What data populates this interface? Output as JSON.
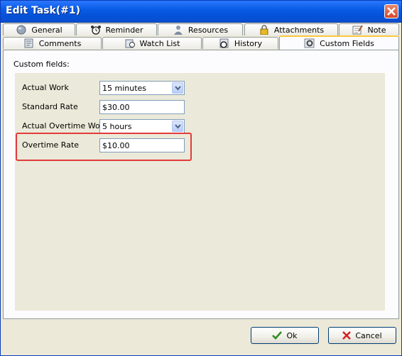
{
  "window": {
    "title": "Edit Task(#1)"
  },
  "tabs_top": [
    {
      "label": "General",
      "icon": "globe-icon"
    },
    {
      "label": "Reminder",
      "icon": "alarm-clock-icon"
    },
    {
      "label": "Resources",
      "icon": "user-icon"
    },
    {
      "label": "Attachments",
      "icon": "lock-icon"
    },
    {
      "label": "Note",
      "icon": "notepad-icon"
    }
  ],
  "tabs_bottom": [
    {
      "label": "Comments",
      "icon": "comments-icon"
    },
    {
      "label": "Watch List",
      "icon": "watch-list-icon"
    },
    {
      "label": "History",
      "icon": "history-icon"
    },
    {
      "label": "Custom Fields",
      "icon": "gear-icon",
      "active": true
    }
  ],
  "custom_fields": {
    "section_label": "Custom fields:",
    "fields": [
      {
        "label": "Actual Work",
        "type": "dropdown",
        "value": "15 minutes"
      },
      {
        "label": "Standard Rate",
        "type": "text",
        "value": "$30.00"
      },
      {
        "label": "Actual Overtime Work",
        "type": "dropdown",
        "value": "5 hours"
      },
      {
        "label": "Overtime Rate",
        "type": "text",
        "value": "$10.00"
      }
    ]
  },
  "buttons": {
    "ok": "Ok",
    "cancel": "Cancel"
  },
  "colors": {
    "highlight": "#e23b3b",
    "titlebar": "#0553d8",
    "active_tab_accent": "#ffc83c"
  }
}
